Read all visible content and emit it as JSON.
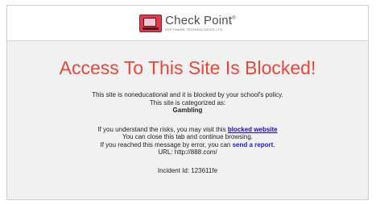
{
  "brand": {
    "name": "Check Point",
    "tagline": "SOFTWARE TECHNOLOGIES LTD."
  },
  "heading": "Access To This Site Is Blocked!",
  "message": {
    "line1": "This site is noneducational and it is blocked by your school's policy.",
    "line2": "This site is categorized as:",
    "category": "Gambling"
  },
  "risk": {
    "prefix": "If you understand the risks, you may visit this",
    "link": "blocked website",
    "close_text": "You can close this tab and continue browsing.",
    "error_prefix": "If you reached this message by error, you can",
    "report_link": "send a report",
    "period": ".",
    "url_line": "URL: http://888.com/"
  },
  "incident": "Incident Id: 123611fe"
}
